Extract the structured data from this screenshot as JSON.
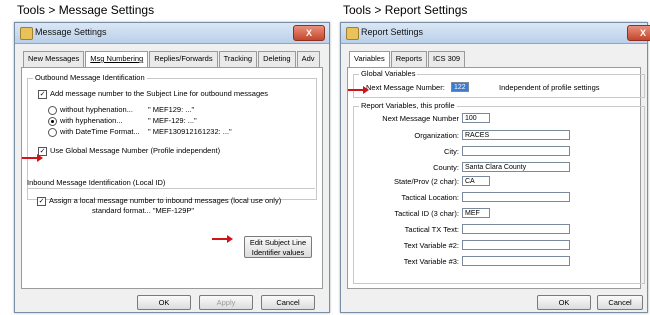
{
  "captions": {
    "left": "Tools > Message Settings",
    "right": "Tools > Report Settings"
  },
  "message_settings": {
    "title": "Message Settings",
    "close_glyph": "X",
    "tabs": [
      "New Messages",
      "Msg Numbering",
      "Replies/Forwards",
      "Tracking",
      "Deleting",
      "Adv"
    ],
    "outbound": {
      "legend": "Outbound Message Identification",
      "add_number_label": "Add message number to the Subject Line for outbound messages",
      "options": [
        {
          "label": "without hyphenation...",
          "example": "\" MEF129: ...\""
        },
        {
          "label": "with hyphenation...",
          "example": "\" MEF-129: ...\""
        },
        {
          "label": "with DateTime Format...",
          "example": "\" MEF130912161232: ...\""
        }
      ],
      "global_label": "Use Global Message Number (Profile independent)"
    },
    "inbound": {
      "legend": "Inbound Message Identification (Local ID)",
      "assign_line1": "Assign a local message number to inbound messages (local use only)",
      "assign_line2": "standard format... \"MEF-129P\""
    },
    "edit_button_line1": "Edit Subject Line",
    "edit_button_line2": "Identifier values",
    "ok": "OK",
    "apply": "Apply",
    "cancel": "Cancel"
  },
  "report_settings": {
    "title": "Report Settings",
    "tabs": [
      "Variables",
      "Reports",
      "ICS 309"
    ],
    "global": {
      "legend": "Global Variables",
      "next_label": "Next Message Number:",
      "next_value": "122",
      "note": "Independent of profile settings"
    },
    "report_vars": {
      "legend": "Report Variables, this profile",
      "fields": [
        {
          "label": "Next Message Number",
          "value": "100"
        },
        {
          "label": "Organization:",
          "value": "RACES"
        },
        {
          "label": "City:",
          "value": ""
        },
        {
          "label": "County:",
          "value": "Santa Clara County"
        },
        {
          "label": "State/Prov (2 char):",
          "value": "CA"
        },
        {
          "label": "Tactical Location:",
          "value": ""
        },
        {
          "label": "Tactical ID (3 char):",
          "value": "MEF"
        },
        {
          "label": "Tactical TX Text:",
          "value": ""
        },
        {
          "label": "Text Variable #2:",
          "value": ""
        },
        {
          "label": "Text Variable #3:",
          "value": ""
        }
      ]
    },
    "ok": "OK",
    "cancel": "Cancel"
  },
  "colors": {
    "arrow": "#d0141a",
    "highlight": "#3a7bd5"
  }
}
